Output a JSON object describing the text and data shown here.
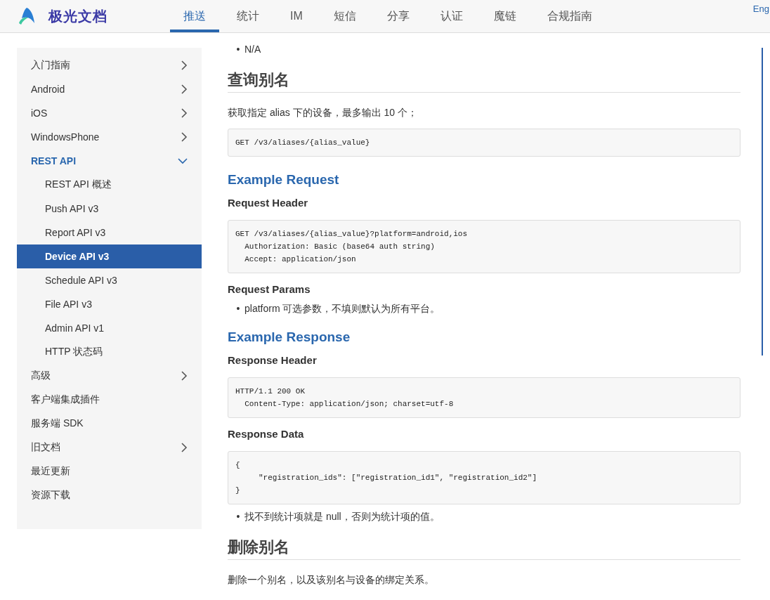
{
  "header": {
    "logo_text": "极光文档",
    "nav": [
      {
        "label": "推送",
        "selected": true
      },
      {
        "label": "统计",
        "selected": false
      },
      {
        "label": "IM",
        "selected": false
      },
      {
        "label": "短信",
        "selected": false
      },
      {
        "label": "分享",
        "selected": false
      },
      {
        "label": "认证",
        "selected": false
      },
      {
        "label": "魔链",
        "selected": false
      },
      {
        "label": "合规指南",
        "selected": false
      }
    ],
    "language_link": "Eng"
  },
  "sidebar": {
    "items": [
      {
        "label": "入门指南",
        "kind": "folder",
        "expanded": false
      },
      {
        "label": "Android",
        "kind": "folder",
        "expanded": false
      },
      {
        "label": "iOS",
        "kind": "folder",
        "expanded": false
      },
      {
        "label": "WindowsPhone",
        "kind": "folder",
        "expanded": false
      },
      {
        "label": "REST API",
        "kind": "folder",
        "expanded": true,
        "children": [
          {
            "label": "REST API 概述",
            "selected": false
          },
          {
            "label": "Push API v3",
            "selected": false
          },
          {
            "label": "Report API v3",
            "selected": false
          },
          {
            "label": "Device API v3",
            "selected": true
          },
          {
            "label": "Schedule API v3",
            "selected": false
          },
          {
            "label": "File API v3",
            "selected": false
          },
          {
            "label": "Admin API v1",
            "selected": false
          },
          {
            "label": "HTTP 状态码",
            "selected": false
          }
        ]
      },
      {
        "label": "高级",
        "kind": "folder",
        "expanded": false
      },
      {
        "label": "客户端集成插件",
        "kind": "page",
        "expanded": false
      },
      {
        "label": "服务端 SDK",
        "kind": "page",
        "expanded": false
      },
      {
        "label": "旧文档",
        "kind": "folder",
        "expanded": false
      },
      {
        "label": "最近更新",
        "kind": "page",
        "expanded": false
      },
      {
        "label": "资源下载",
        "kind": "page",
        "expanded": false
      }
    ]
  },
  "content": {
    "blocks": [
      {
        "kind": "bullets",
        "items": [
          {
            "marker": "•",
            "text": "N/A"
          }
        ]
      },
      {
        "kind": "section_heading",
        "text": "查询别名"
      },
      {
        "kind": "paragraph",
        "text": "获取指定 alias 下的设备，最多输出 10 个；"
      },
      {
        "kind": "code",
        "lines": [
          "GET /v3/aliases/{alias_value}"
        ]
      },
      {
        "kind": "example_heading",
        "text": "Example Request"
      },
      {
        "kind": "label_heading",
        "text": "Request Header"
      },
      {
        "kind": "code",
        "lines": [
          "GET /v3/aliases/{alias_value}?platform=android,ios",
          "  Authorization: Basic (base64 auth string)",
          "  Accept: application/json"
        ]
      },
      {
        "kind": "label_heading",
        "text": "Request Params"
      },
      {
        "kind": "bullets",
        "items": [
          {
            "marker": "•",
            "text": "platform 可选参数，不填则默认为所有平台。"
          }
        ]
      },
      {
        "kind": "example_heading",
        "text": "Example Response"
      },
      {
        "kind": "label_heading",
        "text": "Response Header"
      },
      {
        "kind": "code",
        "lines": [
          "HTTP/1.1 200 OK",
          "  Content-Type: application/json; charset=utf-8"
        ]
      },
      {
        "kind": "label_heading",
        "text": "Response Data"
      },
      {
        "kind": "code",
        "lines": [
          "{",
          "     \"registration_ids\": [\"registration_id1\", \"registration_id2\"]",
          "}"
        ]
      },
      {
        "kind": "bullets",
        "items": [
          {
            "marker": "•",
            "text": "找不到统计项就是 null，否则为统计项的值。"
          }
        ]
      },
      {
        "kind": "section_heading",
        "text": "删除别名"
      },
      {
        "kind": "paragraph",
        "text": "删除一个别名，以及该别名与设备的绑定关系。"
      }
    ]
  },
  "toc": {
    "kind": "rail"
  }
}
